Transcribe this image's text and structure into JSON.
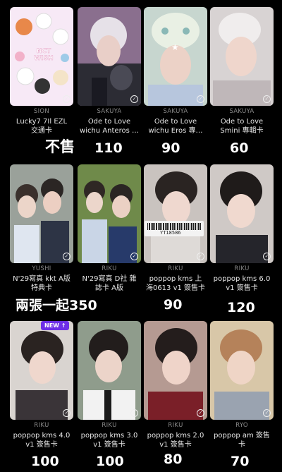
{
  "cards": [
    {
      "member": "SION",
      "title": "Lucky7 7Il EZL\n交通卡",
      "price": "不售"
    },
    {
      "member": "SAKUYA",
      "title": "Ode to Love\nwichu Anteros …",
      "price": "110"
    },
    {
      "member": "SAKUYA",
      "title": "Ode to Love\nwichu Eros 專…",
      "price": "90"
    },
    {
      "member": "SAKUYA",
      "title": "Ode to Love\nSmini 專輯卡",
      "price": "60"
    },
    {
      "member": "YUSHI",
      "title": "N'29寫真 kkt A版\n特典卡",
      "price": ""
    },
    {
      "member": "RIKU",
      "title": "N'29寫真 D社 雜\n誌卡 A版",
      "price": ""
    },
    {
      "member": "RIKU",
      "title": "poppop kms 上\n海0613 v1 簽售卡",
      "price": "90"
    },
    {
      "member": "RIKU",
      "title": "poppop kms 6.0\nv1 簽售卡",
      "price": "120"
    },
    {
      "member": "RIKU",
      "title": "poppop kms 4.0\nv1 簽售卡",
      "price": "100"
    },
    {
      "member": "RIKU",
      "title": "poppop kms 3.0\nv1 簽售卡",
      "price": "100"
    },
    {
      "member": "RIKU",
      "title": "poppop kms 2.0\nv1 簽售卡",
      "price": "80"
    },
    {
      "member": "RYO",
      "title": "poppop am 簽售\n卡",
      "price": "70"
    }
  ],
  "combo_price": "兩張一起350",
  "new_badge": "NEW ↑",
  "sticker_text": "NCT WISH",
  "barcode_number": "YT18586"
}
